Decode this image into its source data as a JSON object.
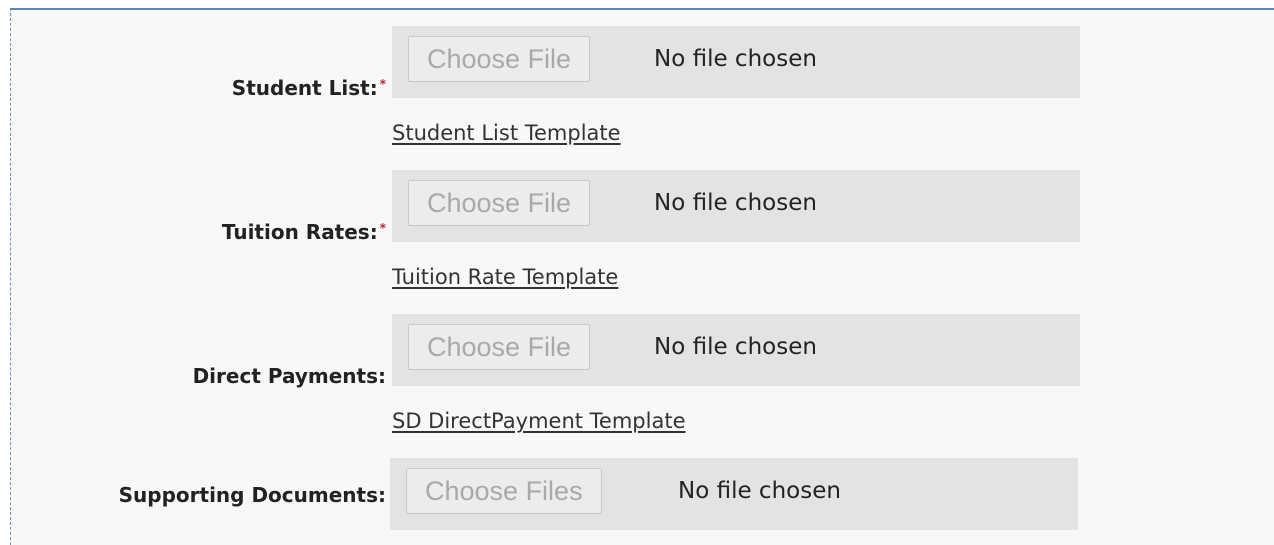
{
  "form": {
    "rows": [
      {
        "label": "Student List:",
        "required_marker": "*",
        "button_label": "Choose File",
        "status": "No file chosen",
        "template_link": "Student List Template"
      },
      {
        "label": "Tuition Rates:",
        "required_marker": "*",
        "button_label": "Choose File",
        "status": "No file chosen",
        "template_link": "Tuition Rate Template"
      },
      {
        "label": "Direct Payments:",
        "button_label": "Choose File",
        "status": "No file chosen",
        "template_link": "SD DirectPayment Template"
      },
      {
        "label": "Supporting Documents:",
        "button_label": "Choose Files",
        "status": "No file chosen"
      }
    ]
  },
  "colors": {
    "required_marker": "#c0203a",
    "frame_border": "#5b86c5",
    "file_box_background": "#e3e3e3"
  }
}
